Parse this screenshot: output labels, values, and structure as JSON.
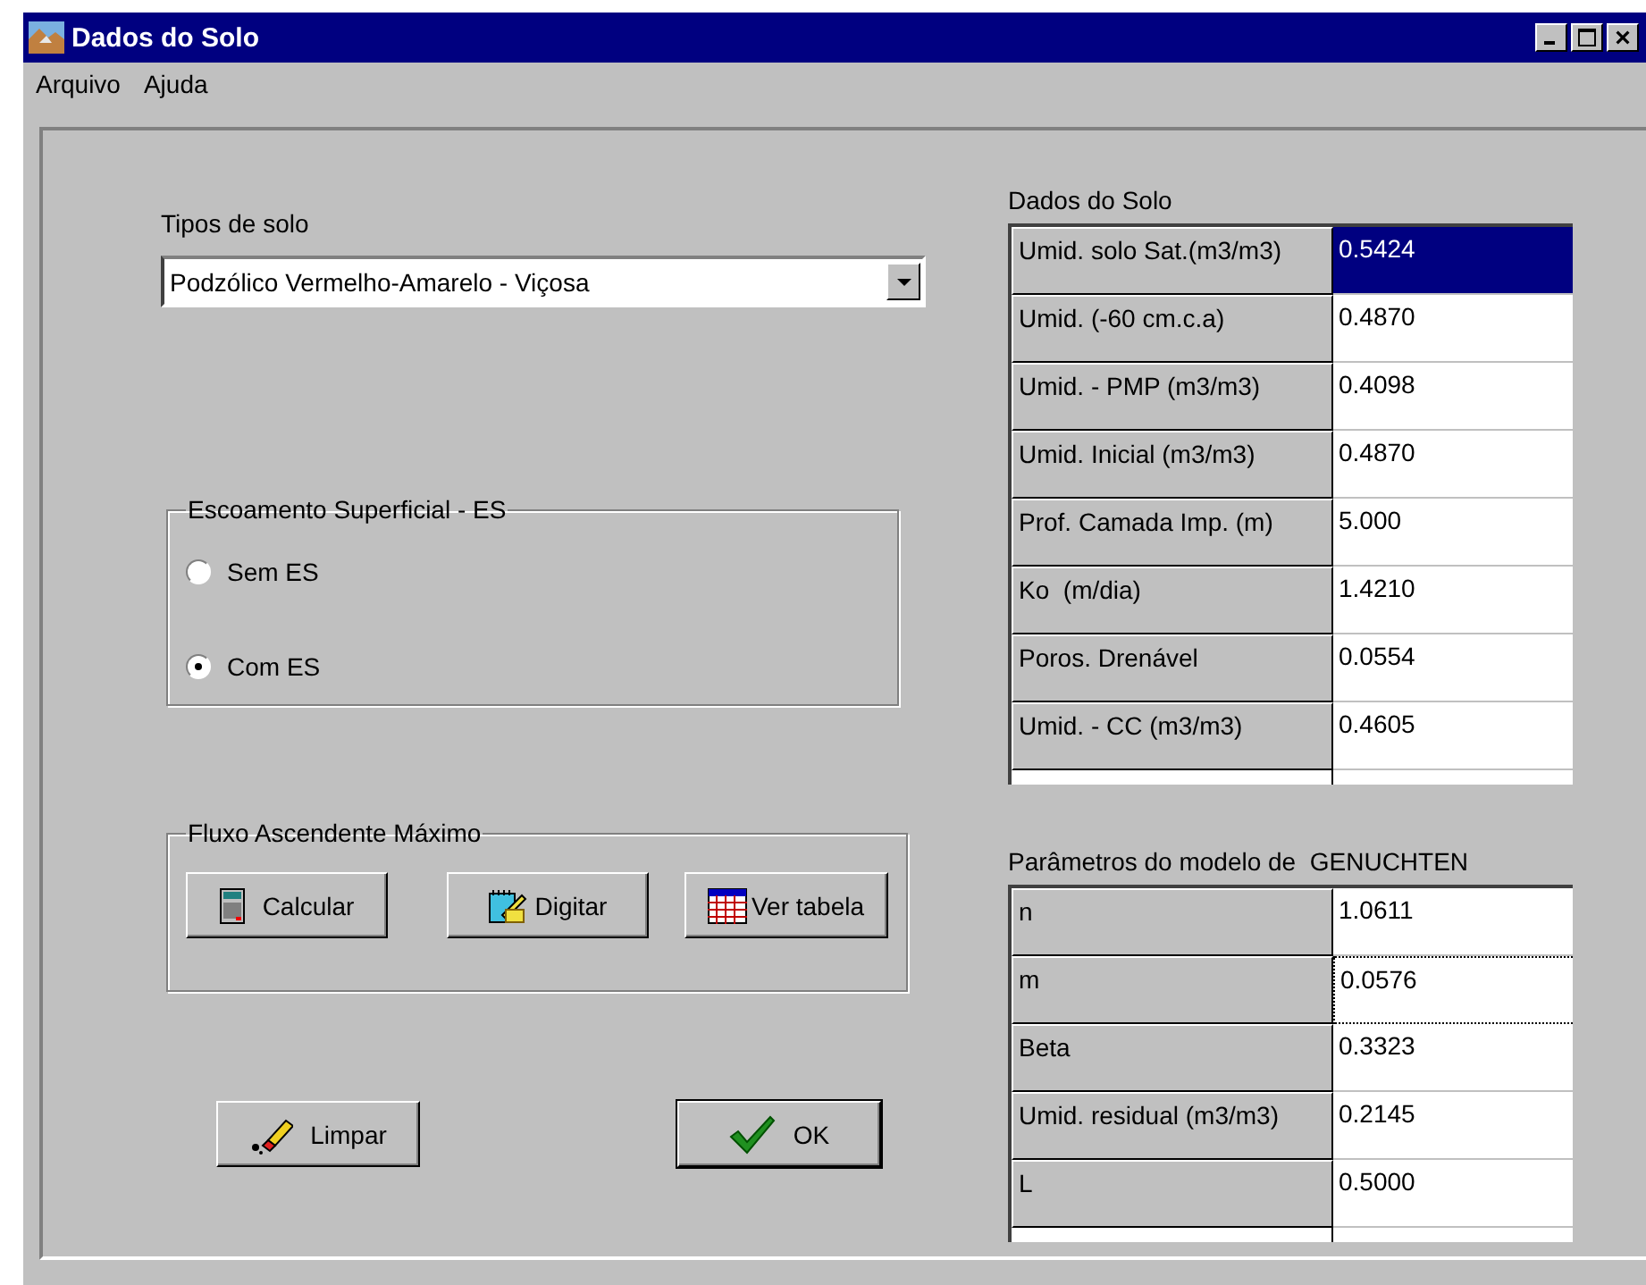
{
  "window": {
    "title": "Dados do Solo"
  },
  "menu": [
    "Arquivo",
    "Ajuda"
  ],
  "soil_type": {
    "label": "Tipos de solo",
    "value": "Podzólico Vermelho-Amarelo - Viçosa"
  },
  "runoff": {
    "title": "Escoamento Superficial - ES",
    "options": [
      {
        "label": "Sem ES",
        "selected": false
      },
      {
        "label": "Com ES",
        "selected": true
      }
    ]
  },
  "flux": {
    "title": "Fluxo Ascendente Máximo",
    "buttons": [
      {
        "label": "Calcular",
        "kind": "calculator"
      },
      {
        "label": "Digitar",
        "kind": "notepad"
      },
      {
        "label": "Ver tabela",
        "kind": "table"
      }
    ]
  },
  "actions": [
    {
      "label": "Limpar",
      "kind": "eraser"
    },
    {
      "label": "OK",
      "kind": "check"
    }
  ],
  "soil_data": {
    "title": "Dados do Solo",
    "rows": [
      {
        "label": "Umid. solo Sat.(m3/m3)",
        "value": "0.5424",
        "selected": true
      },
      {
        "label": "Umid. (-60 cm.c.a)",
        "value": "0.4870",
        "selected": false
      },
      {
        "label": "Umid. - PMP (m3/m3)",
        "value": "0.4098",
        "selected": false
      },
      {
        "label": "Umid. Inicial (m3/m3)",
        "value": "0.4870",
        "selected": false
      },
      {
        "label": "Prof. Camada Imp. (m)",
        "value": "5.000",
        "selected": false
      },
      {
        "label": "Ko  (m/dia)",
        "value": "1.4210",
        "selected": false
      },
      {
        "label": "Poros. Drenável",
        "value": "0.0554",
        "selected": false
      },
      {
        "label": "Umid. - CC (m3/m3)",
        "value": "0.4605",
        "selected": false
      }
    ]
  },
  "genuchten": {
    "title": "Parâmetros do modelo de  GENUCHTEN",
    "rows": [
      {
        "label": "n",
        "value": "1.0611",
        "focused": false
      },
      {
        "label": "m",
        "value": "0.0576",
        "focused": true
      },
      {
        "label": "Beta",
        "value": "0.3323",
        "focused": false
      },
      {
        "label": "Umid. residual (m3/m3)",
        "value": "0.2145",
        "focused": false
      },
      {
        "label": "L",
        "value": "0.5000",
        "focused": false
      }
    ]
  }
}
